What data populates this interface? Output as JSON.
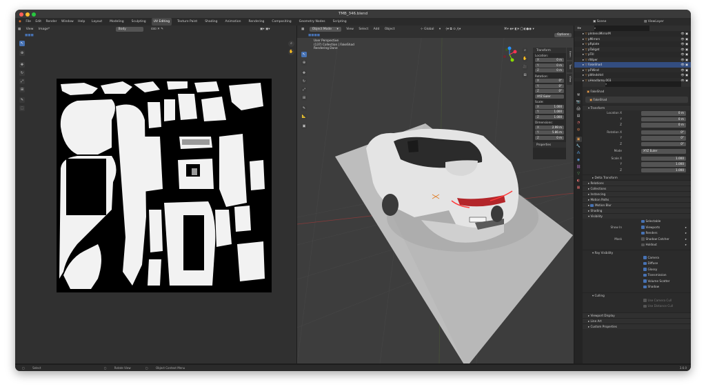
{
  "window": {
    "title": "TMB_346.blend"
  },
  "menu": [
    "File",
    "Edit",
    "Render",
    "Window",
    "Help"
  ],
  "workspaces": [
    "Layout",
    "Modeling",
    "Sculpting",
    "UV Editing",
    "Texture Paint",
    "Shading",
    "Animation",
    "Rendering",
    "Compositing",
    "Geometry Nodes",
    "Scripting"
  ],
  "active_workspace": "UV Editing",
  "scene": {
    "label": "Scene",
    "view_layer": "ViewLayer"
  },
  "uv_editor": {
    "menus": [
      "View",
      "Image*"
    ],
    "uv_map": "Body"
  },
  "viewport": {
    "mode": "Object Mode",
    "menus": [
      "View",
      "Select",
      "Add",
      "Object"
    ],
    "orientation": "Global",
    "options": "Options",
    "info": [
      "User Perspective",
      "(137) Collection | FakeShad",
      "Rendering Done"
    ],
    "side_tabs": [
      "Item",
      "Tool",
      "View"
    ]
  },
  "transform_panel": {
    "title": "Transform",
    "location_label": "Location:",
    "location": [
      {
        "axis": "X",
        "value": "0 m"
      },
      {
        "axis": "Y",
        "value": "0 m"
      },
      {
        "axis": "Z",
        "value": "0 m"
      }
    ],
    "rotation_label": "Rotation:",
    "rotation": [
      {
        "axis": "X",
        "value": "0°"
      },
      {
        "axis": "Y",
        "value": "0°"
      },
      {
        "axis": "Z",
        "value": "0°"
      }
    ],
    "rotation_mode": "XYZ Euler",
    "scale_label": "Scale:",
    "scale": [
      {
        "axis": "X",
        "value": "1.000"
      },
      {
        "axis": "Y",
        "value": "1.000"
      },
      {
        "axis": "Z",
        "value": "1.000"
      }
    ],
    "dimensions_label": "Dimensions:",
    "dimensions": [
      {
        "axis": "X",
        "value": "2.99 m"
      },
      {
        "axis": "Y",
        "value": "5.86 m"
      },
      {
        "axis": "Z",
        "value": "0 m"
      }
    ],
    "properties": "Properties"
  },
  "outliner": {
    "items": [
      "pIntensiMirrorM",
      "pMirrors",
      "pRplate",
      "pTailgat",
      "pTill",
      "rWiper",
      "FakeShad",
      "pFWind",
      "pWindshld",
      "pHeadlamp.003"
    ],
    "selected": "FakeShad"
  },
  "properties": {
    "object_name": "FakeShad",
    "data_name": "FakeShad",
    "transform_title": "Transform",
    "location": [
      {
        "label": "Location X",
        "value": "0 m"
      },
      {
        "label": "Y",
        "value": "0 m"
      },
      {
        "label": "Z",
        "value": "0 m"
      }
    ],
    "rotation": [
      {
        "label": "Rotation X",
        "value": "0°"
      },
      {
        "label": "Y",
        "value": "0°"
      },
      {
        "label": "Z",
        "value": "0°"
      }
    ],
    "mode": {
      "label": "Mode",
      "value": "XYZ Euler"
    },
    "scale": [
      {
        "label": "Scale X",
        "value": "1.000"
      },
      {
        "label": "Y",
        "value": "1.000"
      },
      {
        "label": "Z",
        "value": "1.000"
      }
    ],
    "delta": "Delta Transform",
    "collapsed": [
      "Relations",
      "Collections",
      "Instancing",
      "Motion Paths"
    ],
    "motion_blur": "Motion Blur",
    "shading": "Shading",
    "visibility": "Visibility",
    "selectable": "Selectable",
    "show_in": "Show In",
    "viewports": "Viewports",
    "renders": "Renders",
    "mask": "Mask",
    "shadow_catcher": "Shadow Catcher",
    "holdout": "Holdout",
    "ray_visibility": "Ray Visibility",
    "rays": [
      "Camera",
      "Diffuse",
      "Glossy",
      "Transmission",
      "Volume Scatter",
      "Shadow"
    ],
    "culling": "Culling",
    "culls": [
      "Use Camera Cull",
      "Use Distance Cull"
    ],
    "tail": [
      "Viewport Display",
      "Line Art",
      "Custom Properties"
    ]
  },
  "status": {
    "items": [
      "Select",
      "Rotate View",
      "Object Context Menu"
    ],
    "version": "3.6.0"
  }
}
